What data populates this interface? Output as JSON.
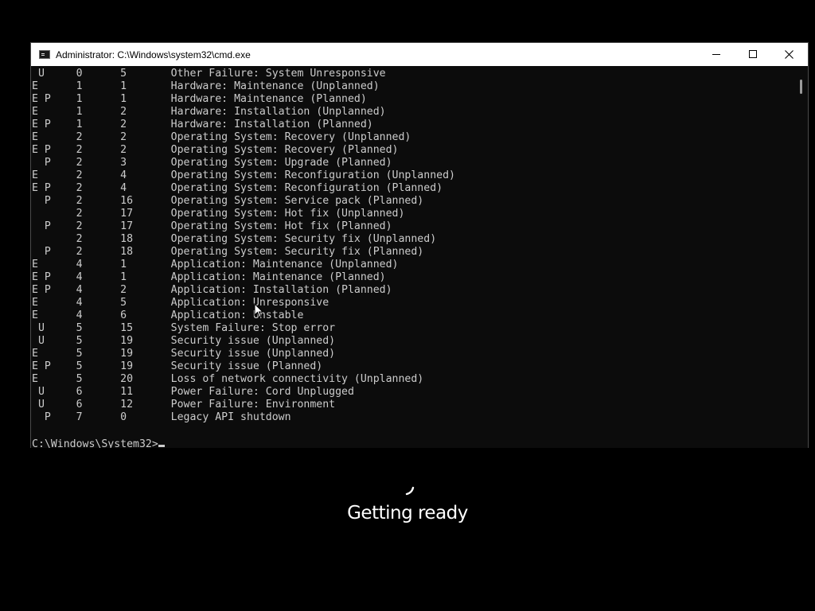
{
  "window": {
    "title": "Administrator: C:\\Windows\\system32\\cmd.exe"
  },
  "console": {
    "lines": [
      " U     0      5       Other Failure: System Unresponsive",
      "E      1      1       Hardware: Maintenance (Unplanned)",
      "E P    1      1       Hardware: Maintenance (Planned)",
      "E      1      2       Hardware: Installation (Unplanned)",
      "E P    1      2       Hardware: Installation (Planned)",
      "E      2      2       Operating System: Recovery (Unplanned)",
      "E P    2      2       Operating System: Recovery (Planned)",
      "  P    2      3       Operating System: Upgrade (Planned)",
      "E      2      4       Operating System: Reconfiguration (Unplanned)",
      "E P    2      4       Operating System: Reconfiguration (Planned)",
      "  P    2      16      Operating System: Service pack (Planned)",
      "       2      17      Operating System: Hot fix (Unplanned)",
      "  P    2      17      Operating System: Hot fix (Planned)",
      "       2      18      Operating System: Security fix (Unplanned)",
      "  P    2      18      Operating System: Security fix (Planned)",
      "E      4      1       Application: Maintenance (Unplanned)",
      "E P    4      1       Application: Maintenance (Planned)",
      "E P    4      2       Application: Installation (Planned)",
      "E      4      5       Application: Unresponsive",
      "E      4      6       Application: Unstable",
      " U     5      15      System Failure: Stop error",
      " U     5      19      Security issue (Unplanned)",
      "E      5      19      Security issue (Unplanned)",
      "E P    5      19      Security issue (Planned)",
      "E      5      20      Loss of network connectivity (Unplanned)",
      " U     6      11      Power Failure: Cord Unplugged",
      " U     6      12      Power Failure: Environment",
      "  P    7      0       Legacy API shutdown",
      ""
    ],
    "prompt": "C:\\Windows\\System32>"
  },
  "overlay": {
    "status_text": "Getting ready"
  },
  "icons": {
    "title_icon": "cmd-console-icon",
    "minimize": "minimize-icon",
    "maximize": "maximize-icon",
    "close": "close-icon",
    "spinner": "loading-spinner-icon",
    "pointer": "mouse-pointer-icon"
  },
  "colors": {
    "console_background": "#0c0c0c",
    "console_text": "#cccccc",
    "titlebar_background": "#ffffff",
    "desktop_background": "#000000",
    "status_text": "#ffffff"
  }
}
